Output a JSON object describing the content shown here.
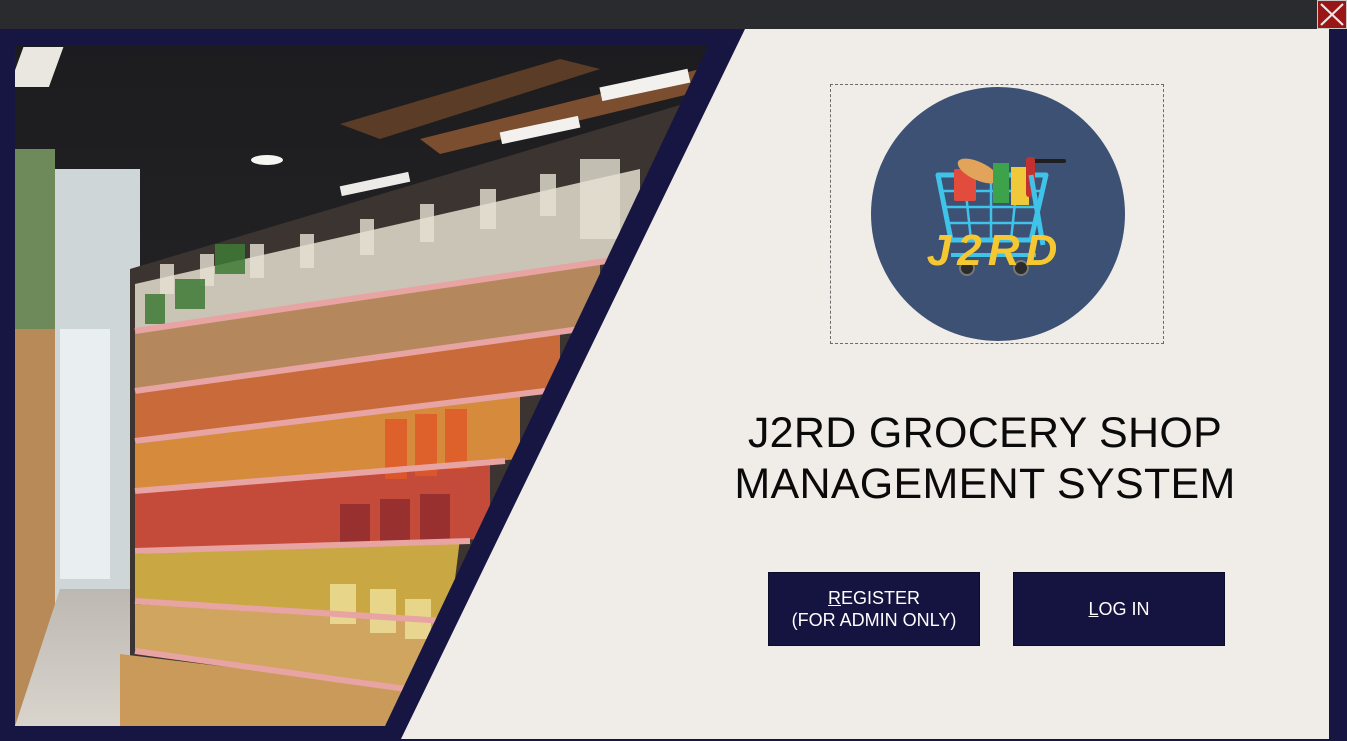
{
  "window": {
    "close_icon": "close-x-icon",
    "accent_color": "#151441",
    "close_color": "#9a1515"
  },
  "hero_image": {
    "description_icon": "supermarket-aisle-photo"
  },
  "logo": {
    "text": "J2RD",
    "icon": "shopping-cart-icon",
    "circle_color": "#3d5175",
    "text_color": "#f5c832"
  },
  "title": {
    "line1": "J2RD GROCERY SHOP",
    "line2": "MANAGEMENT SYSTEM"
  },
  "buttons": {
    "register": {
      "mnemonic": "R",
      "rest": "EGISTER",
      "line2": "(FOR ADMIN ONLY)"
    },
    "login": {
      "mnemonic": "L",
      "rest": "OG IN"
    }
  }
}
